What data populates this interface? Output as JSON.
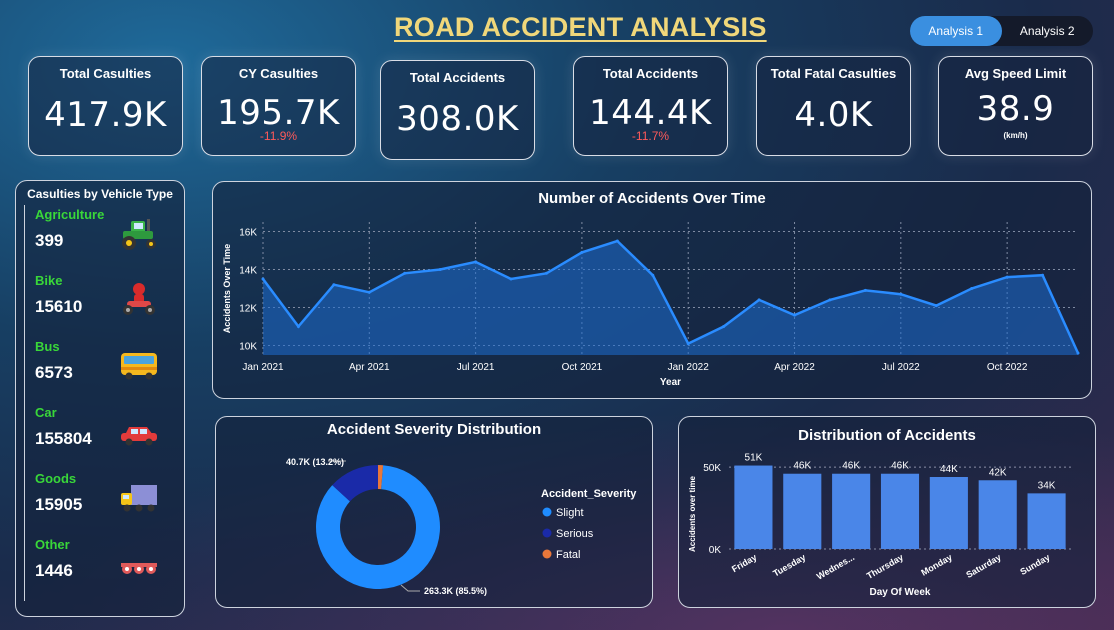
{
  "header": {
    "title": "ROAD ACCIDENT ANALYSIS",
    "tabs": [
      {
        "label": "Analysis 1",
        "active": true
      },
      {
        "label": "Analysis 2",
        "active": false
      }
    ]
  },
  "kpis": [
    {
      "label": "Total Casulties",
      "value": "417.9K",
      "delta": "",
      "unit": ""
    },
    {
      "label": "CY Casulties",
      "value": "195.7K",
      "delta": "-11.9%",
      "unit": ""
    },
    {
      "label": "Total Accidents",
      "value": "308.0K",
      "delta": "",
      "unit": ""
    },
    {
      "label": "Total Accidents",
      "value": "144.4K",
      "delta": "-11.7%",
      "unit": ""
    },
    {
      "label": "Total Fatal Casulties",
      "value": "4.0K",
      "delta": "",
      "unit": ""
    },
    {
      "label": "Avg Speed Limit",
      "value": "38.9",
      "delta": "",
      "unit": "(km/h)"
    }
  ],
  "vehicles": {
    "title": "Casulties by Vehicle Type",
    "items": [
      {
        "label": "Agriculture",
        "count": "399",
        "icon": "tractor-icon"
      },
      {
        "label": "Bike",
        "count": "15610",
        "icon": "motorbike-icon"
      },
      {
        "label": "Bus",
        "count": "6573",
        "icon": "bus-icon"
      },
      {
        "label": "Car",
        "count": "155804",
        "icon": "car-icon"
      },
      {
        "label": "Goods",
        "count": "15905",
        "icon": "truck-icon"
      },
      {
        "label": "Other",
        "count": "1446",
        "icon": "trailer-icon"
      }
    ],
    "label_color": "#39d739"
  },
  "chart_data": [
    {
      "type": "area",
      "title": "Number of Accidents Over Time",
      "xlabel": "Year",
      "ylabel": "Accidents Over Time",
      "ylim": [
        9500,
        16500
      ],
      "yticks": [
        10000,
        12000,
        14000,
        16000
      ],
      "ytick_labels": [
        "10K",
        "12K",
        "14K",
        "16K"
      ],
      "x": [
        "2021-01",
        "2021-02",
        "2021-03",
        "2021-04",
        "2021-05",
        "2021-06",
        "2021-07",
        "2021-08",
        "2021-09",
        "2021-10",
        "2021-11",
        "2021-12",
        "2022-01",
        "2022-02",
        "2022-03",
        "2022-04",
        "2022-05",
        "2022-06",
        "2022-07",
        "2022-08",
        "2022-09",
        "2022-10",
        "2022-11",
        "2022-12"
      ],
      "values": [
        13500,
        11000,
        13200,
        12800,
        13800,
        14000,
        14400,
        13500,
        13800,
        14900,
        15500,
        13700,
        10100,
        11000,
        12400,
        11600,
        12400,
        12900,
        12700,
        12100,
        13000,
        13600,
        13700,
        9600
      ],
      "xtick_labels": [
        "Jan 2021",
        "Apr 2021",
        "Jul 2021",
        "Oct 2021",
        "Jan 2022",
        "Apr 2022",
        "Jul 2022",
        "Oct 2022"
      ],
      "xtick_index": [
        0,
        3,
        6,
        9,
        12,
        15,
        18,
        21
      ],
      "grid": true,
      "color": "#2a8cff"
    },
    {
      "type": "pie",
      "title": "Accident Severity Distribution",
      "legend_title": "Accident_Severity",
      "legend_position": "right",
      "categories": [
        "Slight",
        "Serious",
        "Fatal"
      ],
      "values": [
        263.3,
        40.7,
        4.0
      ],
      "colors": [
        "#1f8cff",
        "#1a2aa8",
        "#e8773a"
      ],
      "data_labels": [
        "263.3K (85.5%)",
        "40.7K (13.2%)",
        ""
      ]
    },
    {
      "type": "bar",
      "title": "Distribution of Accidents",
      "xlabel": "Day Of Week",
      "ylabel": "Accidents over time",
      "categories": [
        "Friday",
        "Tuesday",
        "Wednes...",
        "Thursday",
        "Monday",
        "Saturday",
        "Sunday"
      ],
      "values": [
        51,
        46,
        46,
        46,
        44,
        42,
        34
      ],
      "data_labels": [
        "51K",
        "46K",
        "46K",
        "46K",
        "44K",
        "42K",
        "34K"
      ],
      "ylim": [
        0,
        55
      ],
      "yticks": [
        0,
        50
      ],
      "ytick_labels": [
        "0K",
        "50K"
      ],
      "color": "#4a86e8"
    }
  ]
}
